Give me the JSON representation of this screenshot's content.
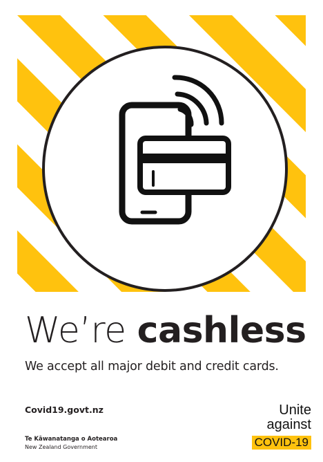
{
  "poster": {
    "headline_light": "We’re",
    "headline_bold": "cashless",
    "subline": "We accept all major debit and credit cards.",
    "website": "Covid19.govt.nz",
    "gov_maori": "Te Kāwanatanga o Aotearoa",
    "gov_english": "New Zealand Government",
    "brand_line1": "Unite",
    "brand_line2": "against",
    "brand_tag": "COVID-19"
  },
  "colors": {
    "stripe_yellow": "#ffc20e",
    "ink": "#231f20",
    "background": "#ffffff"
  },
  "icons": [
    "contactless-phone-card-icon"
  ]
}
